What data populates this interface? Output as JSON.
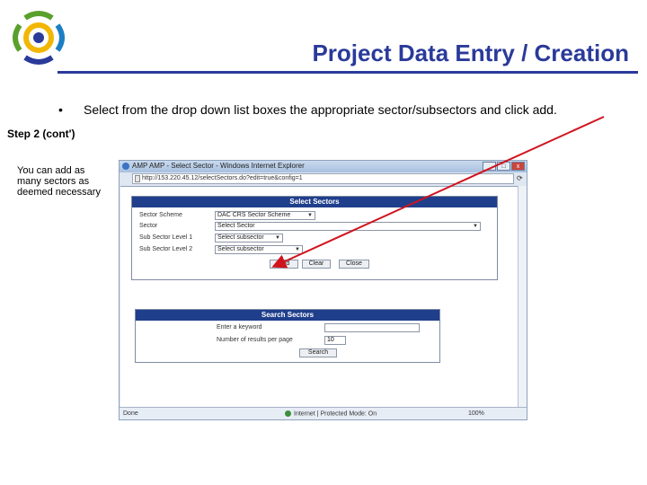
{
  "slide": {
    "title": "Project Data Entry / Creation",
    "bullet": "Select from the drop down list boxes the appropriate sector/subsectors and click add.",
    "step": "Step 2 (cont')",
    "side_note": "You can add as many sectors as deemed necessary"
  },
  "colors": {
    "title": "#2a3a9a",
    "arrow": "#d0141e",
    "panel_header": "#1f3f8c"
  },
  "browser": {
    "window_title": "AMP AMP - Select Sector - Windows Internet Explorer",
    "address": "http://153.220.45.12/selectSectors.do?edit=true&config=1",
    "controls": {
      "minimize": "_",
      "maximize": "□",
      "close": "x"
    },
    "go_icon": "refresh-icon",
    "select_sectors": {
      "header": "Select Sectors",
      "rows": [
        {
          "label": "Sector Scheme",
          "value": "DAC CRS Sector Scheme"
        },
        {
          "label": "Sector",
          "value": "Select Sector"
        },
        {
          "label": "Sub Sector Level 1",
          "value": "Select subsector"
        },
        {
          "label": "Sub Sector Level 2",
          "value": "Select subsector"
        }
      ],
      "buttons": {
        "add": "Add",
        "clear": "Clear",
        "close": "Close"
      }
    },
    "search_sectors": {
      "header": "Search Sectors",
      "keyword_label": "Enter a keyword",
      "keyword_value": "",
      "results_label": "Number of results per page",
      "results_value": "10",
      "search_button": "Search"
    },
    "status": {
      "left": "Done",
      "zone": "Internet | Protected Mode: On",
      "zoom": "100%"
    }
  }
}
